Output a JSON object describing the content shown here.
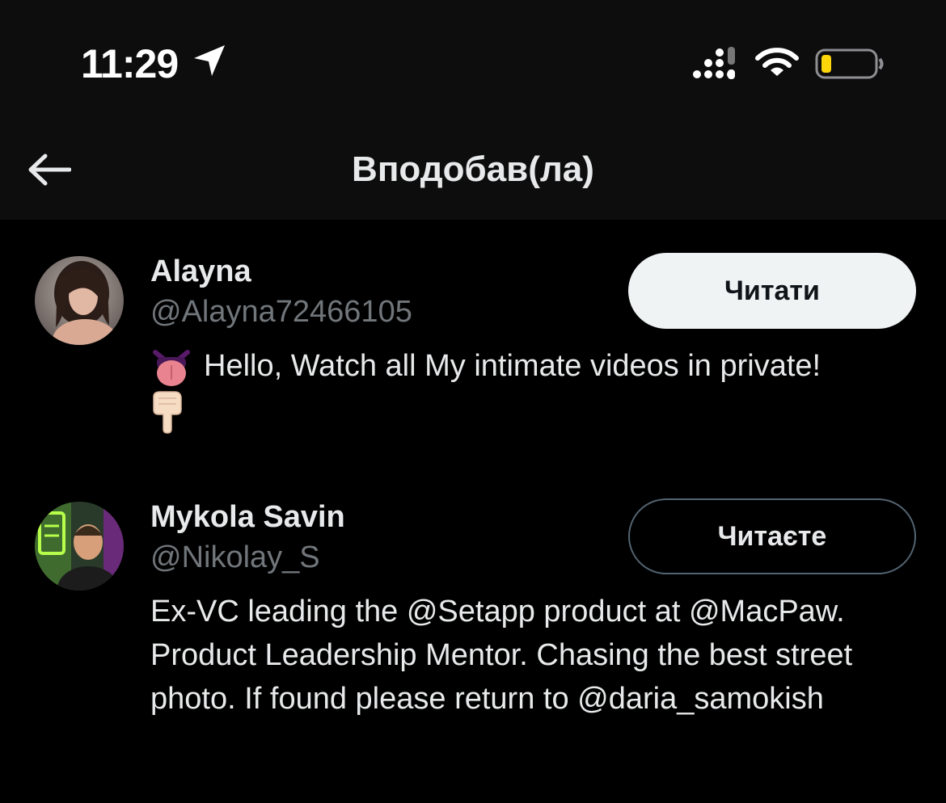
{
  "status_bar": {
    "time": "11:29",
    "icons": [
      "location-arrow-icon",
      "signal-icon",
      "wifi-icon",
      "battery-low-icon"
    ],
    "battery_color": "#ffd60a"
  },
  "header": {
    "title": "Вподобав(ла)",
    "back_icon": "arrow-left-icon"
  },
  "users": [
    {
      "name": "Alayna",
      "handle": "@Alayna72466105",
      "button_label": "Читати",
      "button_state": "follow",
      "bio": "Hello, Watch all My intimate videos in private!",
      "bio_emojis": [
        "tongue-emoji",
        "pointing-down-emoji"
      ]
    },
    {
      "name": "Mykola Savin",
      "handle": "@Nikolay_S",
      "button_label": "Читаєте",
      "button_state": "following",
      "bio": "Ex-VC leading the @Setapp product at @MacPaw. Product Leadership Mentor. Chasing the best street photo. If found please return to @daria_samokish"
    }
  ],
  "colors": {
    "background": "#000000",
    "header_background": "#0d0d0d",
    "text_primary": "#e7e9ea",
    "text_secondary": "#71767b",
    "follow_button_bg": "#eff3f4",
    "following_button_border": "#536471"
  }
}
